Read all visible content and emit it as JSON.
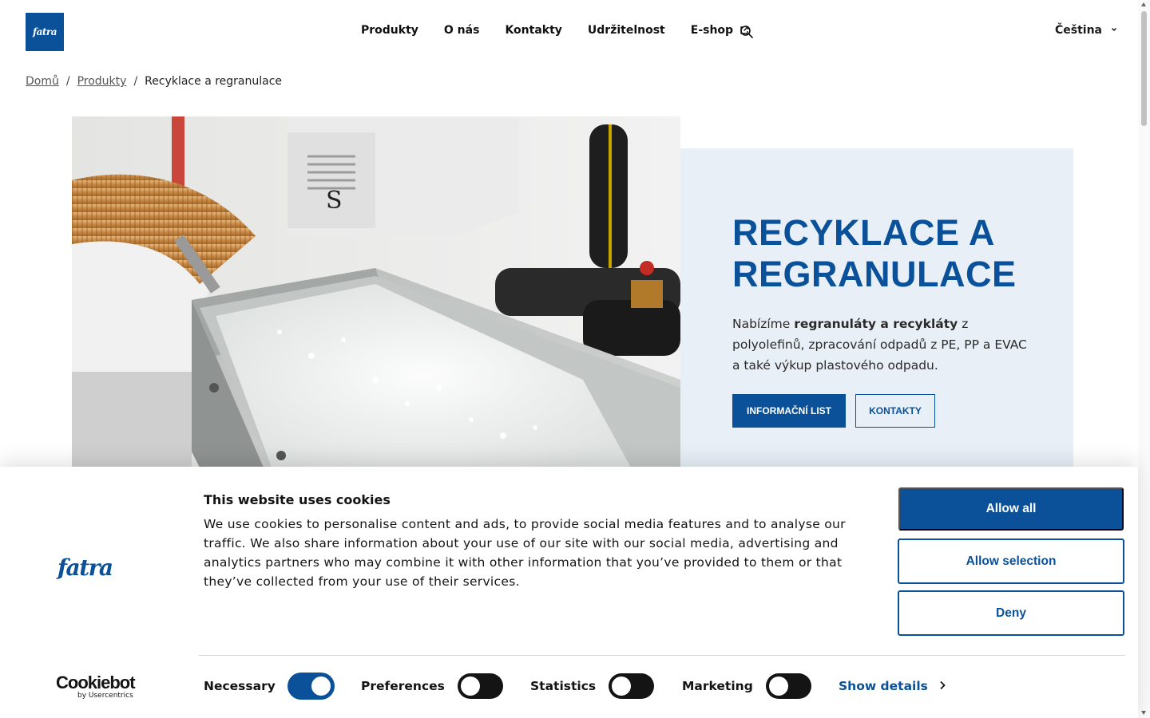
{
  "header": {
    "logo_text": "fatra",
    "nav": [
      {
        "label": "Produkty"
      },
      {
        "label": "O nás"
      },
      {
        "label": "Kontakty"
      },
      {
        "label": "Udržitelnost"
      },
      {
        "label": "E-shop",
        "icon": "external-link-icon"
      }
    ],
    "search_icon": "search-icon",
    "language": "Čeština",
    "language_icon": "chevron-down-icon"
  },
  "breadcrumb": {
    "home": "Domů",
    "products": "Produkty",
    "current": "Recyklace a regranulace",
    "separator": "/"
  },
  "hero": {
    "title": "RECYKLACE A REGRANULACE",
    "text_before": "Nabízíme ",
    "text_bold": "regranuláty a recykláty",
    "text_after": " z polyolefinů, zpracování odpadů z PE, PP a EVAC a také výkup plastového odpadu.",
    "primary_button": "INFORMAČNÍ LIST",
    "secondary_button": "KONTAKTY"
  },
  "cookie_banner": {
    "logo_text": "fatra",
    "title": "This website uses cookies",
    "text": "We use cookies to personalise content and ads, to provide social media features and to analyse our traffic. We also share information about your use of our site with our social media, advertising and analytics partners who may combine it with other information that you’ve provided to them or that they’ve collected from your use of their services.",
    "allow_all": "Allow all",
    "allow_selection": "Allow selection",
    "deny": "Deny",
    "cookiebot_main": "Cookiebot",
    "cookiebot_sub": "by Usercentrics",
    "toggles": [
      {
        "label": "Necessary",
        "on": true
      },
      {
        "label": "Preferences",
        "on": false
      },
      {
        "label": "Statistics",
        "on": false
      },
      {
        "label": "Marketing",
        "on": false
      }
    ],
    "show_details": "Show details"
  },
  "colors": {
    "brand_blue": "#0a5199",
    "hero_panel": "#e8eff6"
  }
}
